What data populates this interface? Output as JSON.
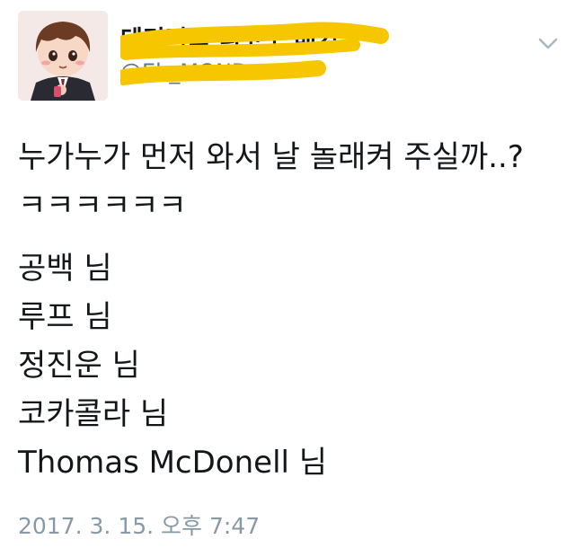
{
  "user": {
    "display_name": "테리리■ 니코노 배기",
    "handle": "@Eh_MOND",
    "avatar_icon": "cartoon-boy-avatar",
    "display_name_redacted": true,
    "handle_redacted": true,
    "redaction_color": "#f6c700"
  },
  "menu": {
    "icon": "chevron-down-icon"
  },
  "tweet": {
    "lines": [
      "누가누가 먼저 와서 날 놀래켜 주실까..?",
      "ㅋㅋㅋㅋㅋㅋ"
    ],
    "names": [
      "공백 님",
      "루프 님",
      "정진운 님",
      "코카콜라 님",
      "Thomas McDonell 님"
    ]
  },
  "timestamp": "2017. 3. 15. 오후 7:47"
}
